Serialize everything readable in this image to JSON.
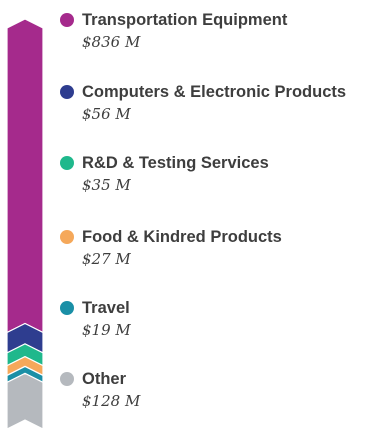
{
  "chart_data": {
    "type": "bar",
    "categories": [
      "Transportation Equipment",
      "Computers & Electronic Products",
      "R&D & Testing Services",
      "Food & Kindred Products",
      "Travel",
      "Other"
    ],
    "values": [
      836,
      56,
      35,
      27,
      19,
      128
    ],
    "value_labels": [
      "$836 M",
      "$56 M",
      "$35 M",
      "$27 M",
      "$19 M",
      "$128 M"
    ],
    "colors": [
      "#a52a8c",
      "#2e3d8f",
      "#1fb88c",
      "#f5a85a",
      "#1a8fa6",
      "#b5b9be"
    ],
    "stacked": true,
    "orientation": "vertical",
    "legend": "right"
  }
}
